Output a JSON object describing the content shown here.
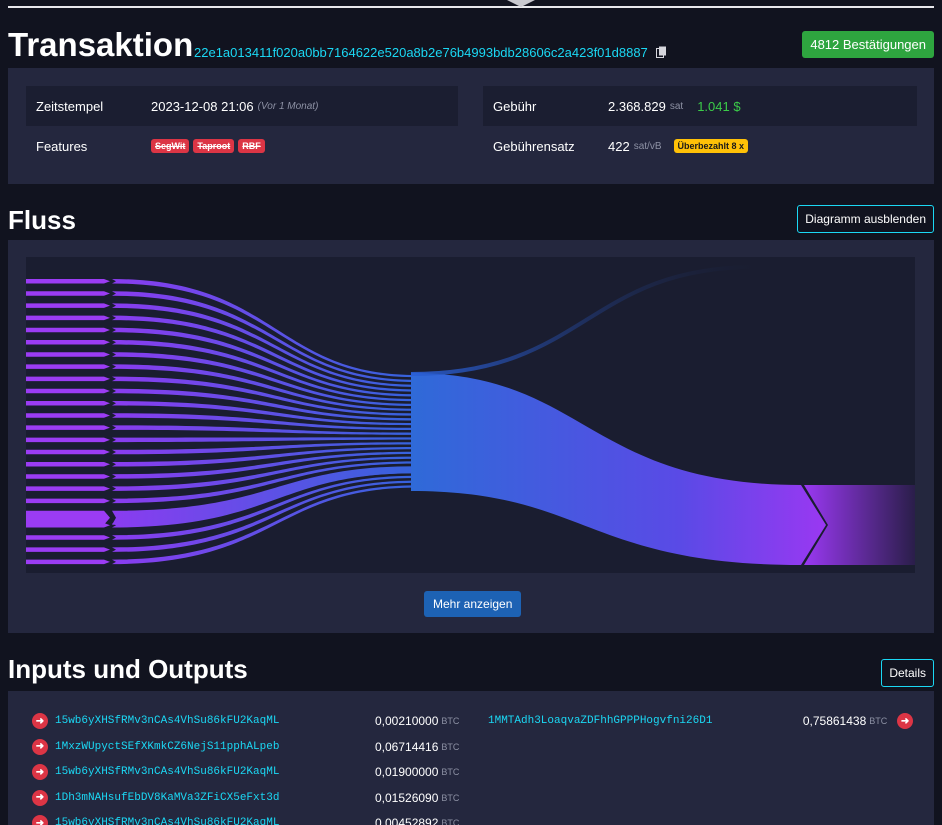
{
  "header": {
    "title": "Transaktion",
    "txid": "22e1a013411f020a0bb7164622e520a8b2e76b4993bdb28606c2a423f01d8887",
    "confirmations": "4812 Bestätigungen"
  },
  "details": {
    "timestamp_label": "Zeitstempel",
    "timestamp_value": "2023-12-08 21:06",
    "timestamp_relative": "(Vor 1 Monat)",
    "features_label": "Features",
    "features": [
      "SegWit",
      "Taproot",
      "RBF"
    ],
    "fee_label": "Gebühr",
    "fee_value": "2.368.829",
    "fee_unit": "sat",
    "fee_fiat": "1.041 $",
    "feerate_label": "Gebührensatz",
    "feerate_value": "422",
    "feerate_unit": "sat/vB",
    "feerate_badge": "Überbezahlt 8 x"
  },
  "flow": {
    "title": "Fluss",
    "hide_button": "Diagramm ausblenden",
    "more_button": "Mehr anzeigen",
    "colors": {
      "purple": "#9b3cf4",
      "blue": "#2f5fdc",
      "dark": "#1a1d30"
    }
  },
  "io": {
    "title": "Inputs und Outputs",
    "details_button": "Details",
    "inputs": [
      {
        "address": "15wb6yXHSfRMv3nCAs4VhSu86kFU2KaqML",
        "amount": "0,00210000",
        "unit": "BTC"
      },
      {
        "address": "1MxzWUpyctSEfXKmkCZ6NejS11pphALpeb",
        "amount": "0,06714416",
        "unit": "BTC"
      },
      {
        "address": "15wb6yXHSfRMv3nCAs4VhSu86kFU2KaqML",
        "amount": "0,01900000",
        "unit": "BTC"
      },
      {
        "address": "1Dh3mNAHsufEbDV8KaMVa3ZFiCX5eFxt3d",
        "amount": "0,01526090",
        "unit": "BTC"
      },
      {
        "address": "15wb6yXHSfRMv3nCAs4VhSu86kFU2KaqML",
        "amount": "0,00452892",
        "unit": "BTC"
      }
    ],
    "outputs": [
      {
        "address": "1MMTAdh3LoaqvaZDFhhGPPPHogvfni26D1",
        "amount": "0,75861438",
        "unit": "BTC"
      }
    ]
  }
}
